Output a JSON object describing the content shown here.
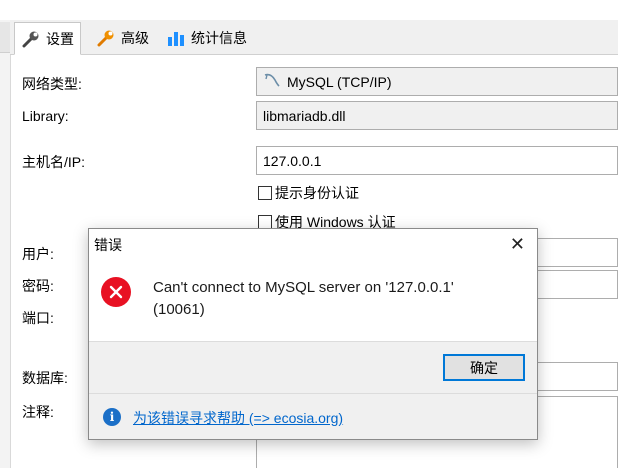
{
  "tabs": [
    {
      "label": "设置",
      "icon": "wrench-icon",
      "active": true
    },
    {
      "label": "高级",
      "icon": "wrench-orange-icon",
      "active": false
    },
    {
      "label": "统计信息",
      "icon": "bar-chart-icon",
      "active": false
    }
  ],
  "form": {
    "network_type_label": "网络类型:",
    "network_type_value": "MySQL (TCP/IP)",
    "network_type_icon": "dolphin-icon",
    "library_label": "Library:",
    "library_value": "libmariadb.dll",
    "host_label": "主机名/IP:",
    "host_value": "127.0.0.1",
    "prompt_credentials_label": "提示身份认证",
    "windows_auth_label": "使用 Windows 认证",
    "user_label": "用户:",
    "password_label": "密码:",
    "port_label": "端口:",
    "database_label": "数据库:",
    "comment_label": "注释:"
  },
  "dialog": {
    "title": "错误",
    "close_glyph": "✕",
    "message_line1": "Can't connect to MySQL server on '127.0.0.1'",
    "message_line2": "(10061)",
    "ok_label": "确定",
    "help_link": "为该错误寻求帮助 (=> ecosia.org)",
    "icon": "error-icon",
    "colors": {
      "error": "#e81123",
      "info": "#1b6fc7",
      "link": "#0066cc",
      "focus": "#0078d7"
    }
  }
}
